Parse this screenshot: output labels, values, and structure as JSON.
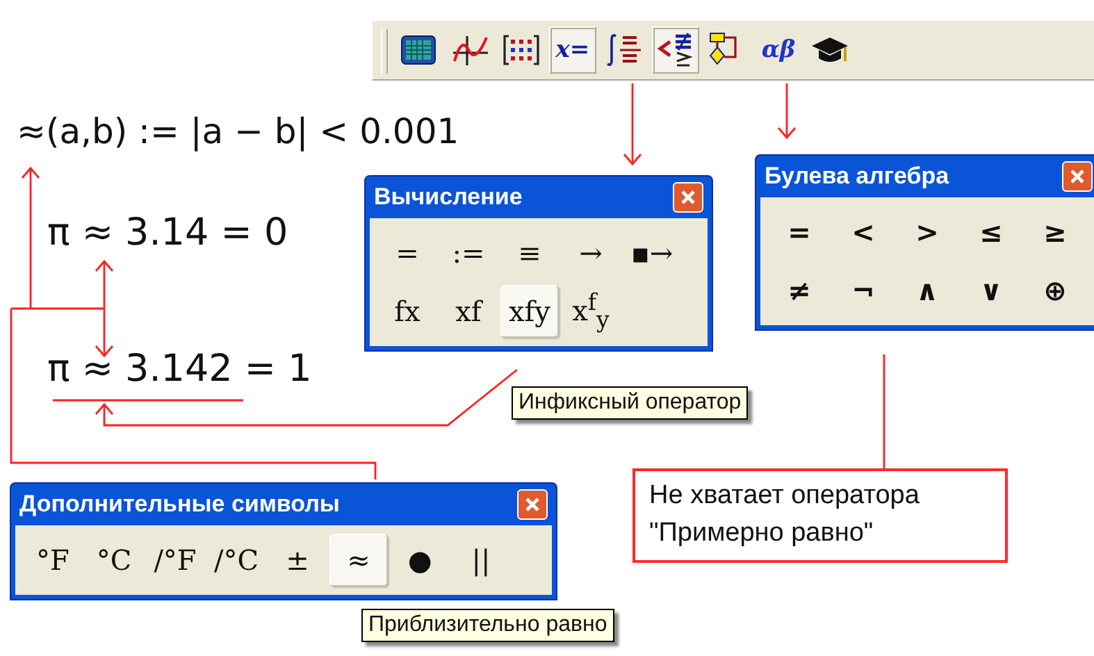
{
  "toolbar": {
    "buttons": [
      {
        "kind": "calculator",
        "selected": false
      },
      {
        "kind": "graph",
        "selected": false
      },
      {
        "kind": "matrix",
        "selected": false
      },
      {
        "kind": "evaluation",
        "label": "x=",
        "selected": true
      },
      {
        "kind": "calculus",
        "selected": false
      },
      {
        "kind": "boolean",
        "selected": true
      },
      {
        "kind": "programming",
        "selected": false
      },
      {
        "kind": "greek",
        "label": "αβ",
        "selected": false
      },
      {
        "kind": "symbolic",
        "selected": false
      }
    ]
  },
  "worksheet": {
    "lines": [
      "≈(a,b) := |a − b| < 0.001",
      "π ≈ 3.14 = 0",
      "π ≈ 3.142 = 1"
    ]
  },
  "palettes": [
    {
      "title": "Вычисление",
      "rows": [
        [
          {
            "label": "=",
            "selected": false
          },
          {
            "label": ":=",
            "selected": false
          },
          {
            "label": "≡",
            "selected": false
          },
          {
            "label": "→",
            "selected": false
          },
          {
            "label": "▪→",
            "selected": false
          }
        ],
        [
          {
            "label": "fx",
            "selected": false
          },
          {
            "label": "xf",
            "selected": false
          },
          {
            "label": "xfy",
            "selected": true
          },
          {
            "label": "x$^{f}$$_{y}$",
            "selected": false
          }
        ]
      ],
      "tooltip": "Инфиксный оператор"
    },
    {
      "title": "Булева алгебра",
      "rows": [
        [
          {
            "label": "=",
            "selected": false
          },
          {
            "label": "<",
            "selected": false
          },
          {
            "label": ">",
            "selected": false
          },
          {
            "label": "≤",
            "selected": false
          },
          {
            "label": "≥",
            "selected": false
          }
        ],
        [
          {
            "label": "≠",
            "selected": false
          },
          {
            "label": "¬",
            "selected": false
          },
          {
            "label": "∧",
            "selected": false
          },
          {
            "label": "∨",
            "selected": false
          },
          {
            "label": "⊕",
            "selected": false
          }
        ]
      ]
    },
    {
      "title": "Дополнительные символы",
      "rows": [
        [
          {
            "label": "°F",
            "selected": false
          },
          {
            "label": "°C",
            "selected": false
          },
          {
            "label": "/°F",
            "selected": false
          },
          {
            "label": "/°C",
            "selected": false
          },
          {
            "label": "±",
            "selected": false
          },
          {
            "label": "≈",
            "selected": true
          },
          {
            "label": "●",
            "selected": false
          },
          {
            "label": "||",
            "selected": false
          }
        ]
      ],
      "tooltip": "Приблизительно равно"
    }
  ],
  "note": {
    "lines": [
      "Не хватает оператора",
      "\"Примерно равно\""
    ]
  }
}
